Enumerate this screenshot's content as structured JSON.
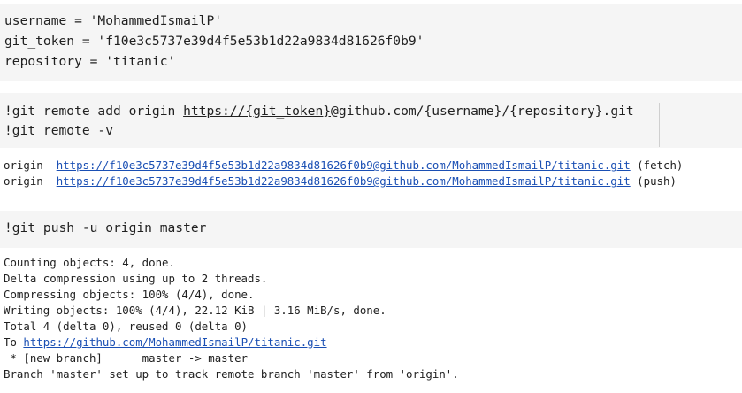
{
  "cell1": {
    "line1": "username = 'MohammedIsmailP'",
    "line2": "git_token = 'f10e3c5737e39d4f5e53b1d22a9834d81626f0b9'",
    "line3": "repository = 'titanic'"
  },
  "cell2": {
    "line1_prefix": "!git remote add origin ",
    "line1_url": "https://{git_token}",
    "line1_suffix": "@github.com/{username}/{repository}.git",
    "line2": "!git remote -v"
  },
  "remote_output": {
    "rows": [
      {
        "name": "origin",
        "url": "https://f10e3c5737e39d4f5e53b1d22a9834d81626f0b9@github.com/MohammedIsmailP/titanic.git",
        "type": "(fetch)"
      },
      {
        "name": "origin",
        "url": "https://f10e3c5737e39d4f5e53b1d22a9834d81626f0b9@github.com/MohammedIsmailP/titanic.git",
        "type": "(push)"
      }
    ]
  },
  "cell3": {
    "line1": "!git push -u origin master"
  },
  "push_output": {
    "line1": "Counting objects: 4, done.",
    "line2": "Delta compression using up to 2 threads.",
    "line3": "Compressing objects: 100% (4/4), done.",
    "line4": "Writing objects: 100% (4/4), 22.12 KiB | 3.16 MiB/s, done.",
    "line5": "Total 4 (delta 0), reused 0 (delta 0)",
    "line6_prefix": "To ",
    "line6_url": "https://github.com/MohammedIsmailP/titanic.git",
    "line7": " * [new branch]      master -> master",
    "line8": "Branch 'master' set up to track remote branch 'master' from 'origin'."
  }
}
